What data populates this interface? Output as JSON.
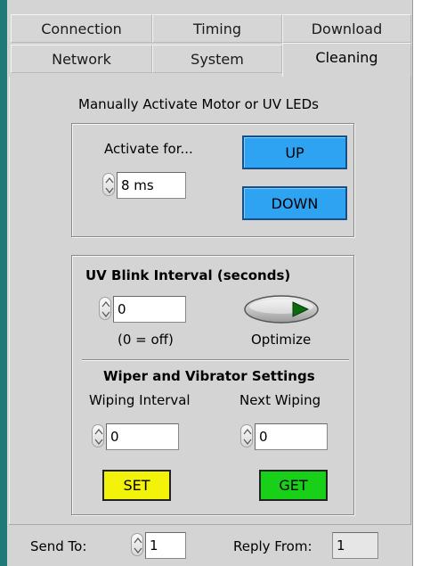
{
  "tabs": {
    "row1": [
      {
        "label": "Connection"
      },
      {
        "label": "Timing"
      },
      {
        "label": "Download"
      }
    ],
    "row2": [
      {
        "label": "Network"
      },
      {
        "label": "System"
      },
      {
        "label": "Cleaning"
      }
    ],
    "active": "Cleaning"
  },
  "manual": {
    "title": "Manually Activate Motor or UV LEDs",
    "activate_label": "Activate for...",
    "activate_value": "8 ms",
    "up_label": "UP",
    "down_label": "DOWN"
  },
  "uv": {
    "title": "UV Blink Interval (seconds)",
    "value": "0",
    "hint": "(0 = off)",
    "optimize_label": "Optimize"
  },
  "wiper": {
    "title": "Wiper and Vibrator Settings",
    "interval_label": "Wiping Interval",
    "interval_value": "0",
    "next_label": "Next Wiping",
    "next_value": "0",
    "set_label": "SET",
    "get_label": "GET"
  },
  "footer": {
    "send_to_label": "Send To:",
    "send_to_value": "1",
    "reply_from_label": "Reply From:",
    "reply_from_value": "1"
  },
  "colors": {
    "panel": "#d4d4d4",
    "button_blue": "#2ea3f2",
    "button_yellow": "#f2f20a",
    "button_green": "#18d018",
    "left_edge": "#1f7a77"
  }
}
